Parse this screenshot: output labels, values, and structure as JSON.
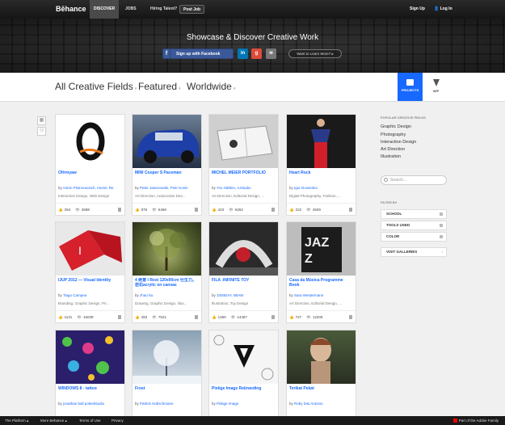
{
  "nav": {
    "logo": "Bēhance",
    "discover": "DISCOVER",
    "jobs": "JOBS",
    "hiring": "Hiring Talent?",
    "post_job": "Post Job",
    "sign_up": "Sign Up",
    "log_in": "Log In"
  },
  "hero": {
    "title": "Showcase & Discover Creative Work",
    "facebook": "Sign up with Facebook",
    "linkedin": "in",
    "google": "g",
    "learn_more": "Want to Learn More?"
  },
  "filters": {
    "fields": "All Creative Fields",
    "sort": "Featured",
    "location": "Worldwide",
    "tab_projects": "PROJECTS",
    "tab_wip": "WIP"
  },
  "projects": [
    {
      "title": "Ofirmyaw",
      "owner": "Anton Pistrovaovich, Atomic Re",
      "fields": "Interaction Design, Web Design",
      "likes": "294",
      "views": "3698"
    },
    {
      "title": "MINI Cooper S Paceman",
      "owner": "Peter Jaworowski, Piotr Kosin",
      "fields": "Art Direction, Automotive Des...",
      "likes": "876",
      "views": "6469"
    },
    {
      "title": "MICHEL MEIER PORTFOLIO",
      "owner": "Yvo Hählen, AJstudio",
      "fields": "Art Direction, Editorial Design, ...",
      "likes": "423",
      "views": "6252"
    },
    {
      "title": "Heart Rock",
      "owner": "Igor Dussenko",
      "fields": "Digital Photography, Fashion, ...",
      "likes": "222",
      "views": "4929"
    },
    {
      "title": "IJUP 2012 — Visual Identity",
      "owner": "Tiago Campea",
      "fields": "Branding, Graphic Design, Pri...",
      "likes": "1131",
      "views": "16039"
    },
    {
      "title": "4 绝意 I Rest 120x90cm 仕生力。岩石acrylic on canvas",
      "owner": "zhao ha",
      "fields": "Drawing, Graphic Design, Illus...",
      "likes": "493",
      "views": "7521"
    },
    {
      "title": "FILA :INFINITE TOY",
      "owner": "1000DAY, 0BAM",
      "fields": "Illustration, Toy Design",
      "likes": "1360",
      "views": "14487"
    },
    {
      "title": "Casa da Música Programme Book",
      "owner": "Sara Westermann",
      "fields": "Art Direction, Editorial Design, ...",
      "likes": "727",
      "views": "12205"
    },
    {
      "title": "WINDOWS 8 - tattoo",
      "owner": "jonathan ball pokedstudio",
      "fields": "",
      "likes": "",
      "views": ""
    },
    {
      "title": "Frost",
      "owner": "Patrick Hübschmann",
      "fields": "",
      "likes": "",
      "views": ""
    },
    {
      "title": "Pistige Image Rebranding",
      "owner": "Pistige Image",
      "fields": "",
      "likes": "",
      "views": ""
    },
    {
      "title": "Terikat Pekat",
      "owner": "Roby Dwi Antonio",
      "fields": "",
      "likes": "",
      "views": ""
    }
  ],
  "by_label": "by",
  "sidebar": {
    "popular_heading": "POPULAR CREATIVE FIELDS",
    "popular": [
      "Graphic Design",
      "Photography",
      "Interaction Design",
      "Art Direction",
      "Illustration"
    ],
    "search_placeholder": "Search...",
    "filter_heading": "FILTER BY",
    "school": "SCHOOL",
    "tools": "TOOLS USED",
    "color": "COLOR",
    "galleries": "VISIT GALLERIES"
  },
  "footer": {
    "platform": "The Platform",
    "more": "More Behance",
    "terms": "Terms of Use",
    "privacy": "Privacy",
    "adobe": "Part of the Adobe Family"
  },
  "colors": {
    "accent": "#1769ff",
    "facebook": "#3b5998",
    "linkedin": "#0077b5",
    "google": "#dd4b39"
  }
}
